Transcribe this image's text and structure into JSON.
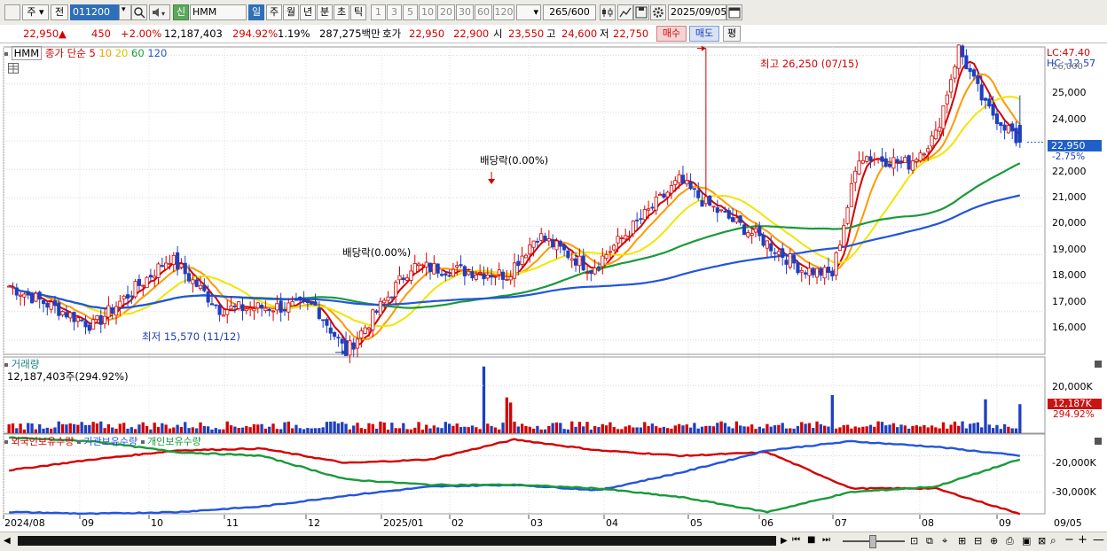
{
  "toolbar": {
    "market_type": "주",
    "prev_label": "전",
    "code": "011200",
    "new_badge": "신",
    "stock_name": "HMM",
    "periods": [
      "일",
      "주",
      "월",
      "년",
      "분",
      "초",
      "틱"
    ],
    "period_selected": 0,
    "intervals": [
      "1",
      "3",
      "5",
      "10",
      "20",
      "30",
      "60",
      "120"
    ],
    "count_value": "265",
    "count_total": "/600",
    "date": "2025/09/05"
  },
  "quote": {
    "price": "22,950",
    "change": "450",
    "change_pct": "+2.00%",
    "volume": "12,187,403",
    "volume_ratio": "294.92%",
    "turnover": "1.19%",
    "amount": "287,275백만",
    "hoga_label": "호가",
    "ask": "22,950",
    "bid": "22,900",
    "open_label": "시",
    "open": "23,550",
    "high_label": "고",
    "high": "24,600",
    "low_label": "저",
    "low": "22,750",
    "buy_label": "매수",
    "sell_label": "매도",
    "avg_label": "평"
  },
  "price_panel": {
    "legend_name": "HMM",
    "legend_ma_label": "종가 단순",
    "ma_periods": [
      "5",
      "10",
      "20",
      "60",
      "120"
    ],
    "ma_colors": [
      "#d40000",
      "#ff9900",
      "#f2e500",
      "#1a9a3a",
      "#2255dd"
    ],
    "lc_label": "LC:47.40",
    "hc_label": "HC:-12.57",
    "price_tag": "22,950",
    "pct_tag": "-2.75%",
    "high_annotation": "최고 26,250 (07/15)",
    "low_annotation": "최저 15,570 (11/12)",
    "dividend_label_1": "배당락(0.00%)",
    "dividend_label_2": "배당락(0.00%)",
    "y_ticks": [
      "25,000",
      "24,000",
      "23,000",
      "22,000",
      "21,000",
      "20,000",
      "19,000",
      "18,000",
      "17,000",
      "16,000"
    ],
    "y_top_partial": "26,000"
  },
  "volume_panel": {
    "title": "거래량",
    "value": "12,187,403주(294.92%)",
    "y_tick": "20,000K",
    "tag": "12,187K",
    "tag_pct": "294.92%"
  },
  "holdings_panel": {
    "legends": [
      "외국인보유수량",
      "기관보유수량",
      "개인보유수량"
    ],
    "legend_colors": [
      "#d40000",
      "#2255dd",
      "#1a9a3a"
    ],
    "y_ticks": [
      "-20,000K",
      "-30,000K"
    ]
  },
  "x_axis": [
    "2024/08",
    "09",
    "10",
    "11",
    "12",
    "2025/01",
    "02",
    "03",
    "04",
    "05",
    "06",
    "07",
    "08",
    "09",
    "09/05"
  ],
  "chart_data": {
    "type": "candlestick",
    "title": "",
    "series": [
      {
        "name": "5",
        "type": "line"
      },
      {
        "name": "10",
        "type": "line"
      },
      {
        "name": "20",
        "type": "line"
      },
      {
        "name": "60",
        "type": "line"
      },
      {
        "name": "120",
        "type": "line"
      }
    ],
    "price_keypoints": [
      {
        "date": "2024/08",
        "close": 17900
      },
      {
        "date": "2024/09",
        "close": 16500
      },
      {
        "date": "2024/09",
        "close": 18900
      },
      {
        "date": "2024/10",
        "close": 17100
      },
      {
        "date": "2024/11",
        "close": 17200
      },
      {
        "date": "2024/11/12",
        "close": 15570
      },
      {
        "date": "2024/12",
        "close": 18600
      },
      {
        "date": "2025/01",
        "close": 18300
      },
      {
        "date": "2025/01",
        "close": 19700
      },
      {
        "date": "2025/02",
        "close": 18500
      },
      {
        "date": "2025/03",
        "close": 21600
      },
      {
        "date": "2025/03",
        "close": 20800
      },
      {
        "date": "2025/04",
        "close": 19500
      },
      {
        "date": "2025/04",
        "close": 18500
      },
      {
        "date": "2025/05",
        "close": 18300
      },
      {
        "date": "2025/05",
        "close": 22500
      },
      {
        "date": "2025/06",
        "close": 22200
      },
      {
        "date": "2025/06",
        "close": 23200
      },
      {
        "date": "2025/07/15",
        "close": 26250
      },
      {
        "date": "2025/07",
        "close": 24200
      },
      {
        "date": "2025/08",
        "close": 23300
      },
      {
        "date": "2025/08",
        "close": 22100
      },
      {
        "date": "2025/09/05",
        "close": 22950
      }
    ],
    "last": {
      "open": 23550,
      "high": 24600,
      "low": 22750,
      "close": 22950,
      "volume": 12187403
    },
    "high": {
      "value": 26250,
      "date": "07/15"
    },
    "low": {
      "value": 15570,
      "date": "11/12"
    },
    "ylim": [
      15500,
      26300
    ],
    "volume_ylim_k": [
      0,
      32000
    ],
    "holdings_ylim_k": [
      -36000,
      -14000
    ],
    "holdings_keypoints": {
      "외국인보유수량": [
        -24000,
        -21000,
        -18500,
        -18000,
        -22000,
        -21000,
        -15500,
        -18500,
        -20000,
        -19000,
        -29000,
        -29000,
        -36000
      ],
      "기관보유수량": [
        -35500,
        -36000,
        -35500,
        -34000,
        -31000,
        -28500,
        -28000,
        -29500,
        -24500,
        -18500,
        -16000,
        -17500,
        -20000
      ],
      "개인보유수량": [
        -15000,
        -16000,
        -19000,
        -20000,
        -26500,
        -28000,
        -28000,
        -29000,
        -31500,
        -35500,
        -30000,
        -28500,
        -21000
      ]
    }
  }
}
